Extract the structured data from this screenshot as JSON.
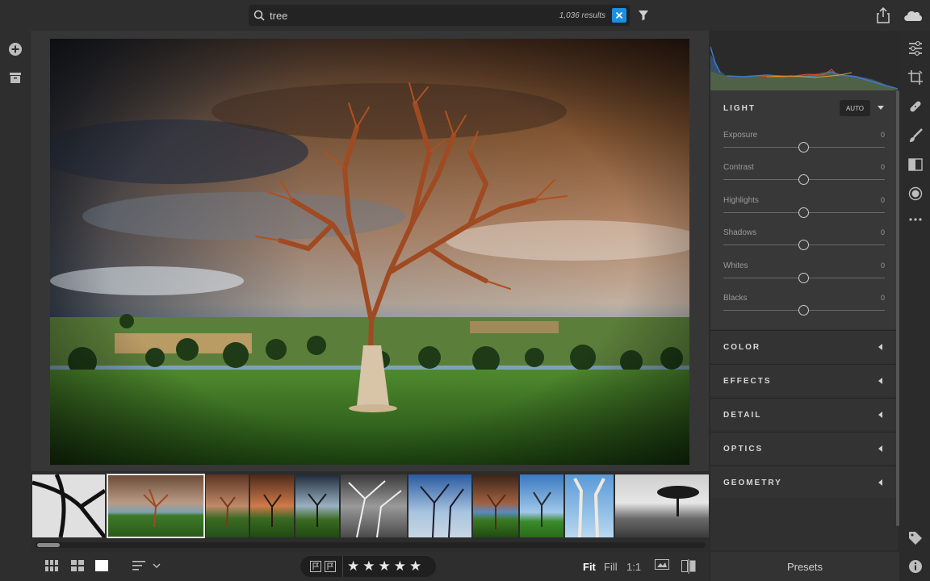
{
  "search": {
    "query": "tree",
    "result_count": "1,036 results",
    "icon": "search-icon"
  },
  "toolbar_top": {
    "filter_icon": "filter-icon",
    "share_icon": "share-icon",
    "cloud_icon": "cloud-icon"
  },
  "left_rail": {
    "add_icon": "add-photos-icon",
    "archive_icon": "archive-icon"
  },
  "edit_panel": {
    "light_section": {
      "title": "LIGHT",
      "auto_label": "AUTO",
      "sliders": [
        {
          "label": "Exposure",
          "value": "0"
        },
        {
          "label": "Contrast",
          "value": "0"
        },
        {
          "label": "Highlights",
          "value": "0"
        },
        {
          "label": "Shadows",
          "value": "0"
        },
        {
          "label": "Whites",
          "value": "0"
        },
        {
          "label": "Blacks",
          "value": "0"
        }
      ]
    },
    "collapsed_sections": [
      "COLOR",
      "EFFECTS",
      "DETAIL",
      "OPTICS",
      "GEOMETRY"
    ]
  },
  "tool_rail": [
    "edit-sliders-icon",
    "crop-icon",
    "healing-icon",
    "brush-icon",
    "linear-gradient-icon",
    "radial-gradient-icon",
    "more-icon",
    "keyword-tag-icon",
    "info-icon"
  ],
  "bottom_bar": {
    "view_modes": [
      "square-grid-small-icon",
      "square-grid-large-icon",
      "detail-view-icon"
    ],
    "sort_icon": "sort-icon",
    "rating_stars": "★★★★★",
    "zoom_options": [
      "Fit",
      "Fill",
      "1:1"
    ],
    "active_zoom": "Fit"
  },
  "presets_label": "Presets",
  "filmstrip": {
    "thumb_count": 10,
    "selected_index": 1
  }
}
